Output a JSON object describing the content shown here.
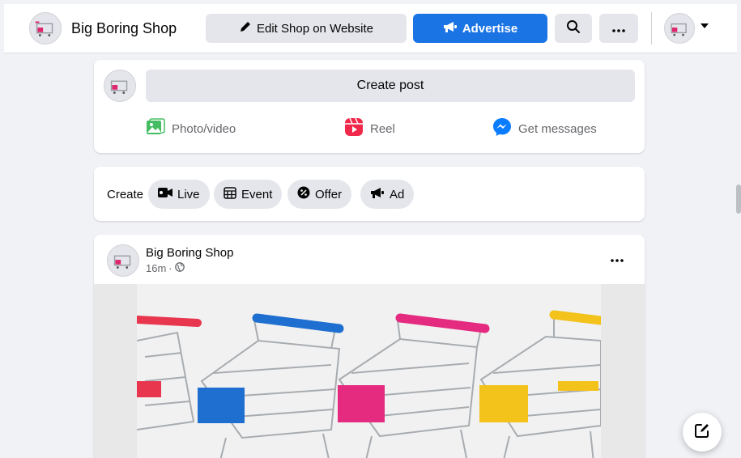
{
  "header": {
    "shop_name": "Big Boring Shop",
    "edit_label": "Edit Shop on Website",
    "advertise_label": "Advertise",
    "icons": {
      "edit": "pencil-icon",
      "advertise": "megaphone-icon",
      "search": "search-icon",
      "more": "more-icon",
      "caret": "caret-down-icon"
    }
  },
  "create_post": {
    "placeholder": "Create post",
    "actions": [
      {
        "label": "Photo/video",
        "icon": "photo-icon",
        "color": "#45bd62"
      },
      {
        "label": "Reel",
        "icon": "reel-icon",
        "color": "#f02849"
      },
      {
        "label": "Get messages",
        "icon": "messenger-icon",
        "color": "#0a7cff"
      }
    ]
  },
  "create_bar": {
    "label": "Create",
    "items": [
      {
        "label": "Live",
        "icon": "live-video-icon"
      },
      {
        "label": "Event",
        "icon": "calendar-icon"
      },
      {
        "label": "Offer",
        "icon": "offer-icon"
      },
      {
        "label": "Ad",
        "icon": "megaphone-icon"
      }
    ]
  },
  "post": {
    "author": "Big Boring Shop",
    "time": "16m",
    "separator": "·",
    "privacy_icon": "globe-icon",
    "image": "shopping-carts-photo"
  },
  "colors": {
    "accent": "#1b74e4",
    "background": "#f0f2f5",
    "button_grey": "#e4e6eb",
    "secondary_text": "#65676b"
  }
}
